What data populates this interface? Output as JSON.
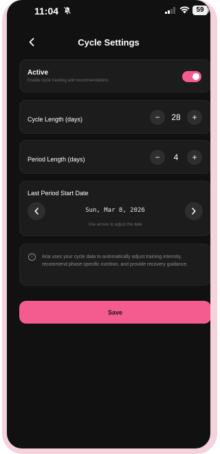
{
  "status_bar": {
    "time": "11:04",
    "battery": "59"
  },
  "header": {
    "title": "Cycle Settings"
  },
  "active": {
    "label": "Active",
    "description": "Enable cycle tracking and recommendations",
    "enabled": true
  },
  "cycle_length": {
    "label": "Cycle Length (days)",
    "value": "28",
    "minus": "−",
    "plus": "+"
  },
  "period_length": {
    "label": "Period Length (days)",
    "value": "4",
    "minus": "−",
    "plus": "+"
  },
  "last_period": {
    "label": "Last Period Start Date",
    "date": "Sun, Mar 8, 2026",
    "hint": "Use arrows to adjust the date"
  },
  "info": {
    "text": "Aria uses your cycle data to automatically adjust training intensity, recommend phase-specific nutrition, and provide recovery guidance."
  },
  "save": {
    "label": "Save"
  },
  "colors": {
    "accent": "#f45c8f",
    "background": "#111111",
    "card": "#1c1c1c",
    "frame": "#f6d3dc"
  },
  "icons": [
    "mute-icon",
    "signal-icon",
    "wifi-icon",
    "back-icon",
    "info-icon",
    "chevron-left-icon",
    "chevron-right-icon"
  ]
}
